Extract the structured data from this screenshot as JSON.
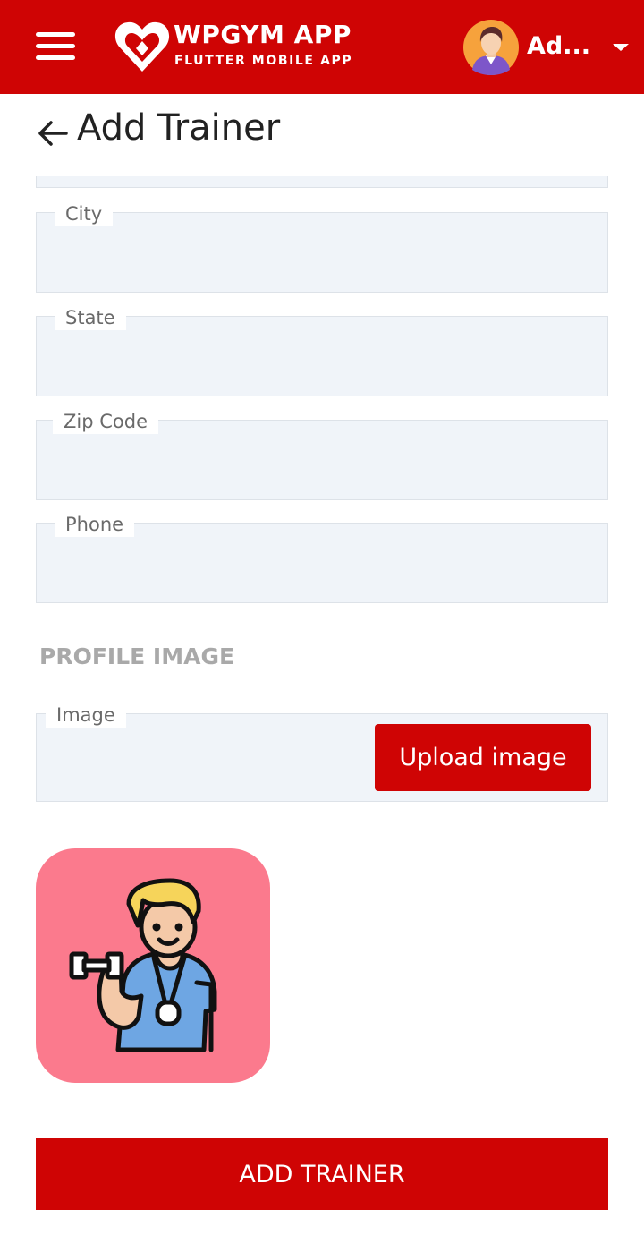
{
  "header": {
    "app_title": "WPGYM APP",
    "app_subtitle": "FLUTTER MOBILE APP",
    "user_name": "Ad...",
    "icons": [
      "menu-icon",
      "logo-heart-icon",
      "avatar",
      "chevron-down-icon"
    ]
  },
  "page": {
    "title": "Add Trainer",
    "back_icon": "arrow-left-icon"
  },
  "form": {
    "fields": [
      {
        "label": "City",
        "value": ""
      },
      {
        "label": "State",
        "value": ""
      },
      {
        "label": "Zip Code",
        "value": ""
      },
      {
        "label": "Phone",
        "value": ""
      }
    ],
    "profile_section_title": "PROFILE IMAGE",
    "image_label": "Image",
    "upload_button": "Upload image",
    "submit_button": "ADD TRAINER"
  },
  "colors": {
    "primary_red": "#cf0404",
    "field_background": "#f0f4f9",
    "preview_background": "#fb7a8d"
  }
}
